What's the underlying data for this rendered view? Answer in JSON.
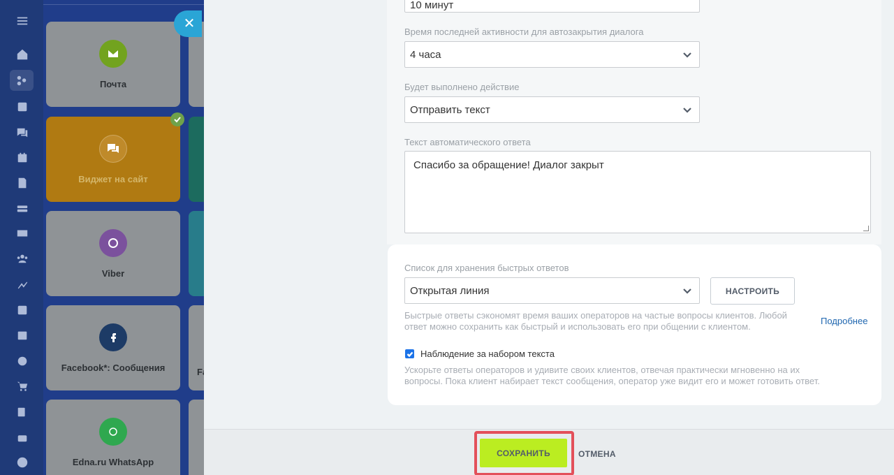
{
  "connectors": [
    {
      "label": "Почта",
      "icon": "mail-icon",
      "color": "#72a31f"
    },
    {
      "label": "Виджет на сайт",
      "icon": "chat-bubbles-icon",
      "color": "#bf8a2a",
      "connected": true
    },
    {
      "label": "Viber",
      "icon": "viber-icon",
      "color": "#7b519d"
    },
    {
      "label": "Facebook*: Сообщения",
      "icon": "facebook-icon",
      "color": "#1d3b66"
    },
    {
      "label": "Edna.ru WhatsApp",
      "icon": "edna-icon",
      "color": "#2fa84f"
    }
  ],
  "connectors_right": {
    "partial_label_fb": "Fa"
  },
  "form": {
    "top_select_value": "10 минут",
    "autoclose_label": "Время последней активности для автозакрытия диалога",
    "autoclose_value": "4 часа",
    "action_label": "Будет выполнено действие",
    "action_value": "Отправить текст",
    "reply_label": "Текст автоматического ответа",
    "reply_text": "Спасибо за обращение! Диалог закрыт",
    "quick_list_label": "Список для хранения быстрых ответов",
    "quick_list_value": "Открытая линия",
    "configure_button": "НАСТРОИТЬ",
    "quick_hint_line1": "Быстрые ответы сэкономят время ваших операторов на частые вопросы клиентов. Любой",
    "quick_hint_line2": "ответ можно сохранить как быстрый и использовать его при общении с клиентом.",
    "more_link": "Подробнее",
    "typing_checkbox_label": "Наблюдение за набором текста",
    "typing_checked": true,
    "typing_hint_line1": "Ускорьте ответы операторов и удивите своих клиентов, отвечая практически мгновенно на их",
    "typing_hint_line2": "вопросы. Пока клиент набирает текст сообщения, оператор уже видит его и может готовить ответ."
  },
  "footer": {
    "save_button": "СОХРАНИТЬ",
    "cancel_button": "ОТМЕНА"
  },
  "colors": {
    "save_accent": "#bbed21",
    "highlight_frame": "#e3505a",
    "link": "#2067b0",
    "checkbox": "#1c73e8"
  }
}
